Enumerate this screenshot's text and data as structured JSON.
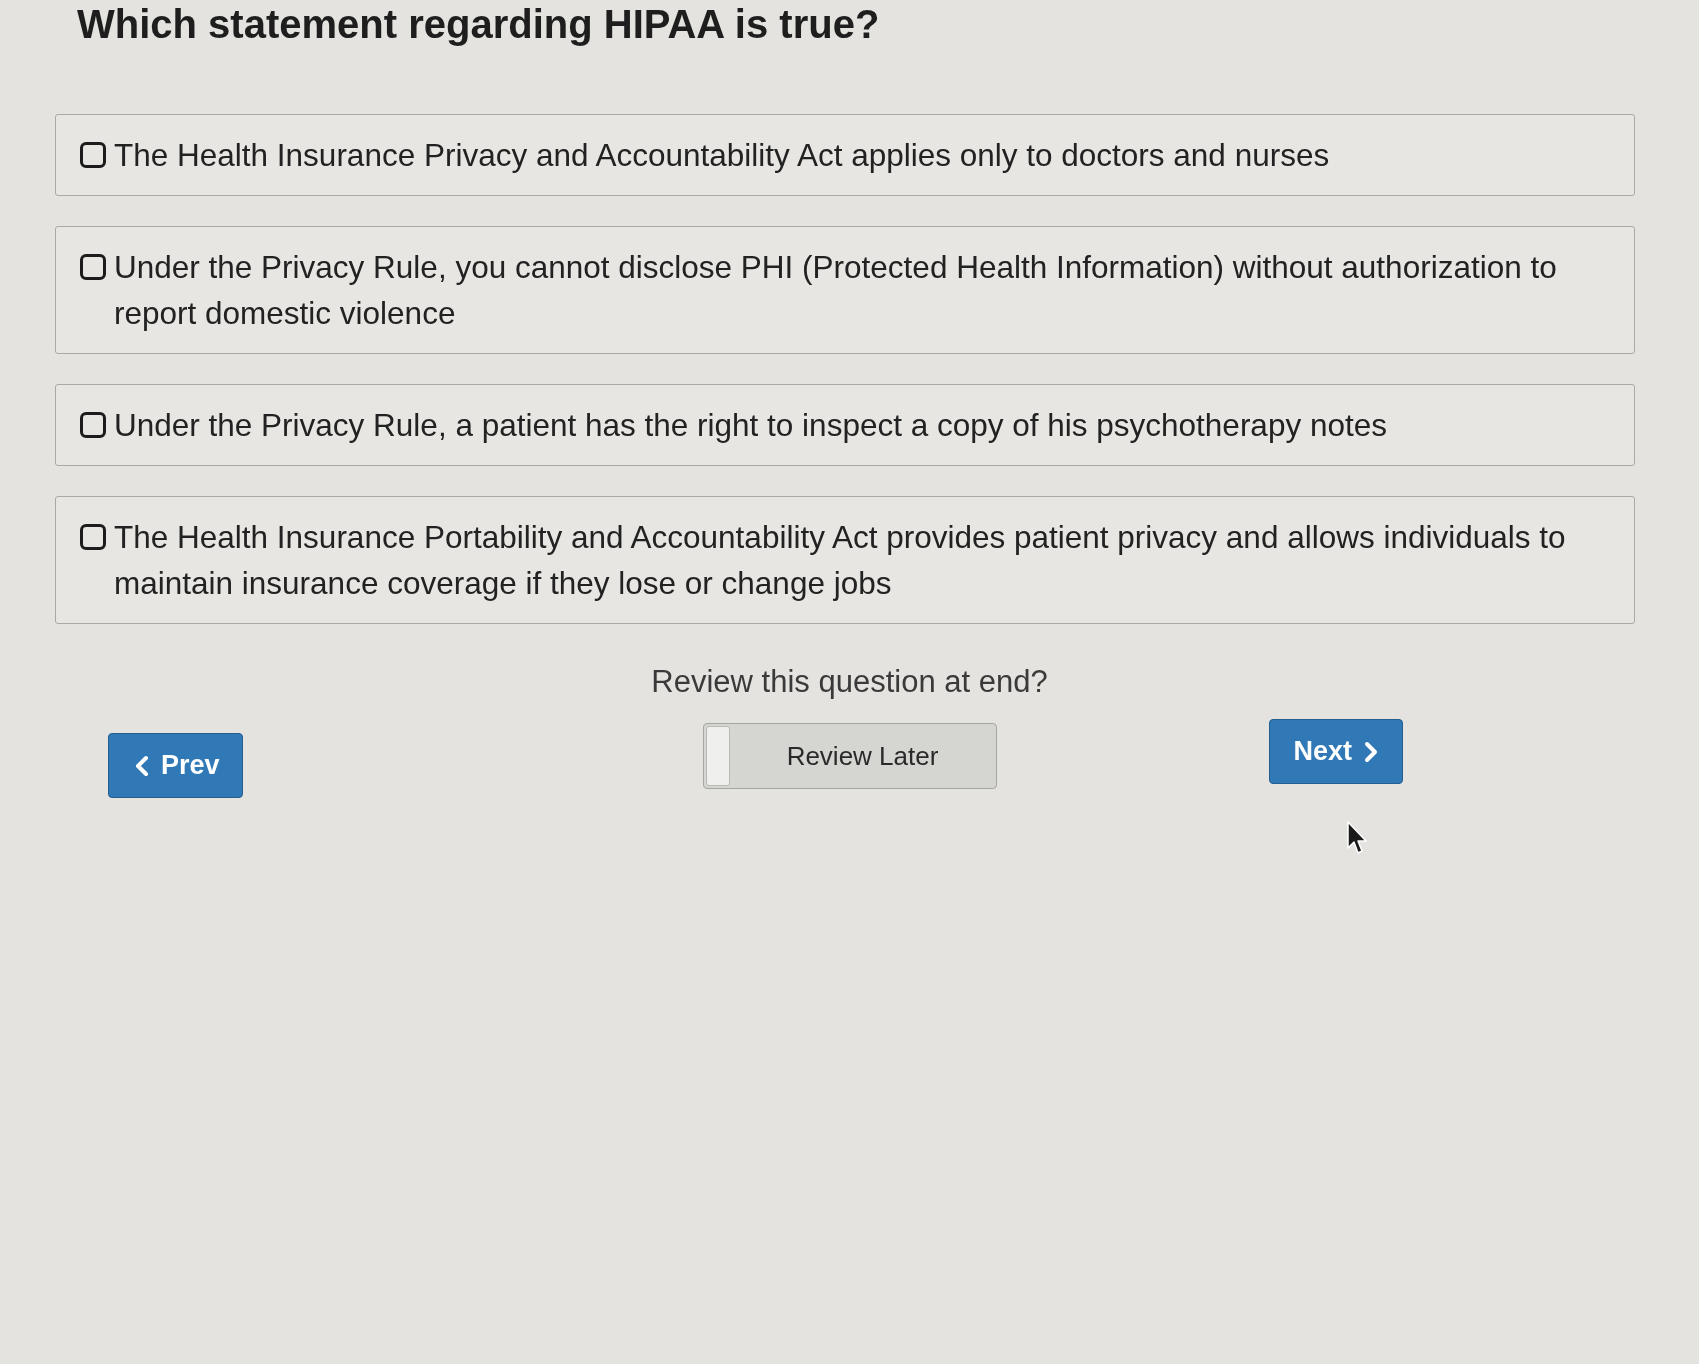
{
  "question": {
    "title": "Which statement regarding HIPAA is true?"
  },
  "options": [
    {
      "text": "The Health Insurance Privacy and Accountability Act applies only to doctors and nurses",
      "checked": false
    },
    {
      "text": "Under the Privacy Rule, you cannot disclose PHI (Protected Health Information) without authorization to report domestic violence",
      "checked": false
    },
    {
      "text": "Under the Privacy Rule, a patient has the right to inspect a copy of his psychotherapy notes",
      "checked": false
    },
    {
      "text": "The Health Insurance Portability and Accountability Act provides patient privacy and allows individuals to maintain insurance coverage if they lose or change jobs",
      "checked": false
    }
  ],
  "review": {
    "prompt": "Review this question at end?",
    "toggle_label": "Review Later",
    "on": false
  },
  "navigation": {
    "prev_label": "Prev",
    "next_label": "Next"
  }
}
